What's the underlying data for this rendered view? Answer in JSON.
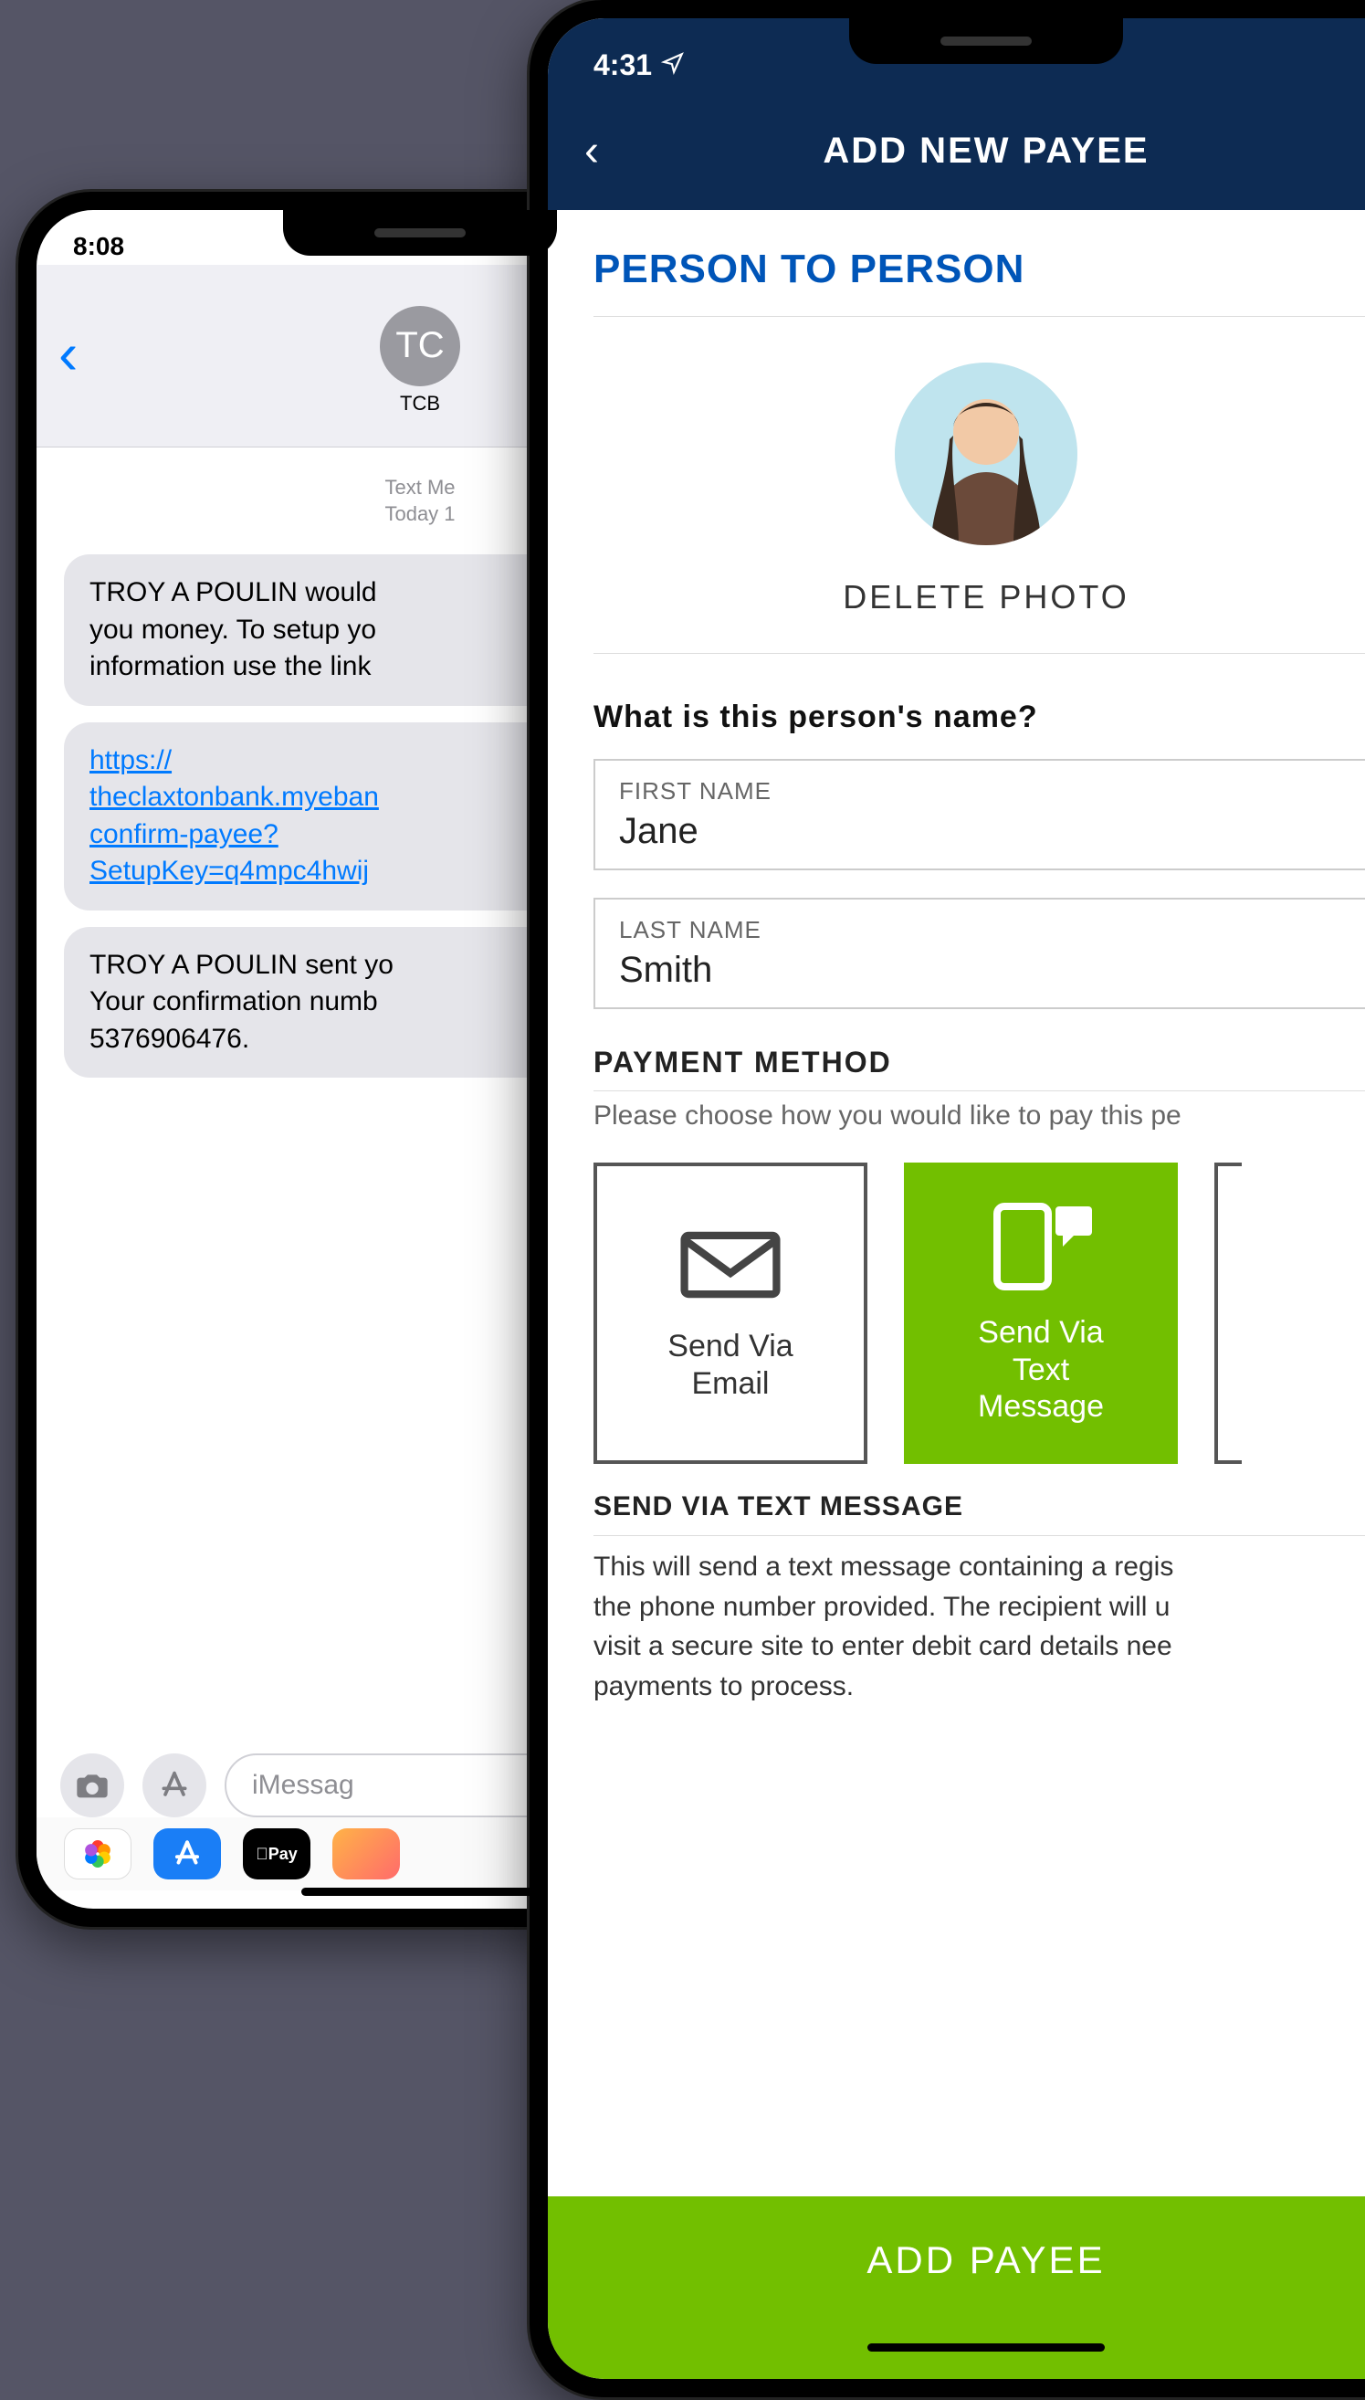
{
  "left_phone": {
    "status_time": "8:08",
    "contact_initials": "TC",
    "contact_name": "TCB",
    "thread_meta": "Text Me\nToday 1",
    "bubble1": "TROY A POULIN would \nyou money. To setup yo\ninformation use the link",
    "bubble2_link": "https://\ntheclaxtonbank.myeban\nconfirm-payee?\nSetupKey=q4mpc4hwij",
    "bubble3": "TROY A POULIN sent yo\nYour confirmation numb\n5376906476.",
    "input_placeholder": "iMessag",
    "dock": {
      "appstore_glyph": "A",
      "applepay_text": "Pay"
    }
  },
  "right_phone": {
    "status_time": "4:31",
    "nav_title": "ADD NEW PAYEE",
    "section_title": "PERSON TO PERSON",
    "delete_photo": "DELETE PHOTO",
    "form": {
      "question": "What is this person's name?",
      "first_label": "FIRST NAME",
      "first_value": "Jane",
      "last_label": "LAST NAME",
      "last_value": "Smith"
    },
    "payment_method": {
      "heading": "PAYMENT METHOD",
      "desc": "Please choose how you would like to pay this pe",
      "option_email": "Send Via\nEmail",
      "option_text": "Send Via\nText\nMessage"
    },
    "sendvia": {
      "heading": "SEND VIA TEXT MESSAGE",
      "desc": "This will send a text message containing a regis\nthe phone number provided. The recipient will u\nvisit a secure site to enter debit card details nee\npayments to process."
    },
    "add_button": "ADD PAYEE"
  }
}
